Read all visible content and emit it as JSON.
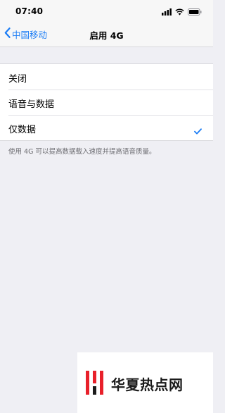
{
  "status_bar": {
    "time": "07:40",
    "icons": [
      "cellular-signal-icon",
      "wifi-icon",
      "battery-icon"
    ]
  },
  "nav": {
    "back_label": "中国移动",
    "title": "启用 4G"
  },
  "options": [
    {
      "label": "关闭",
      "selected": false
    },
    {
      "label": "语音与数据",
      "selected": false
    },
    {
      "label": "仅数据",
      "selected": true
    }
  ],
  "footer_note": "使用 4G 可以提高数据载入速度并提高语音质量。",
  "watermark": {
    "text": "华夏热点网",
    "logo_color": "#e8202a"
  },
  "colors": {
    "accent": "#1a7cf5",
    "background": "#efeff4"
  }
}
